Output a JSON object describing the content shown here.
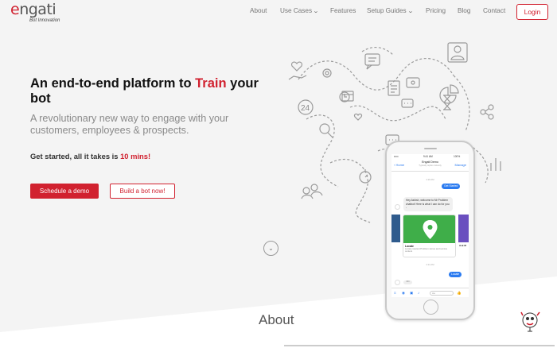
{
  "brand": {
    "logo_text": "ngati",
    "logo_e": "e",
    "tagline": "Bot Innovation",
    "accent": "#d1212f"
  },
  "nav": {
    "items": [
      {
        "label": "About",
        "dropdown": false
      },
      {
        "label": "Use Cases",
        "dropdown": true
      },
      {
        "label": "Features",
        "dropdown": false
      },
      {
        "label": "Setup Guides",
        "dropdown": true
      },
      {
        "label": "Pricing",
        "dropdown": false
      },
      {
        "label": "Blog",
        "dropdown": false
      },
      {
        "label": "Contact",
        "dropdown": false
      }
    ],
    "login_label": "Login"
  },
  "hero": {
    "headline_pre": "An end-to-end platform to ",
    "headline_accent": "Train",
    "headline_post": " your bot",
    "subhead": "A revolutionary new way to engage with your customers, employees & prospects.",
    "get_started_pre": "Get started, all it takes is ",
    "get_started_accent": "10 mins!",
    "primary_button": "Schedule a demo",
    "secondary_button": "Build a bot now!",
    "scroll_icon": "chevron-down-icon"
  },
  "phone": {
    "time": "9:41 AM",
    "battery": "100%",
    "back_label": "Home",
    "chat_title": "Engati Demo",
    "chat_subtitle": "Typically replies instantly",
    "manage_label": "Manage",
    "timestamp_1": "4:20 AM",
    "user_msg_1": "Get Started",
    "bot_msg": "Hey Ashish, welcome to Mr Problem chatbot! Here is what I can do for you -",
    "card_title": "Locate",
    "card_desc": "Locate nearest Problem stores and service centers",
    "side_card_title": "Ask M",
    "timestamp_2": "4:21 AM",
    "user_msg_2": "Locate",
    "typing": "•••",
    "composer_placeholder": "Aa"
  },
  "about": {
    "title": "About"
  }
}
